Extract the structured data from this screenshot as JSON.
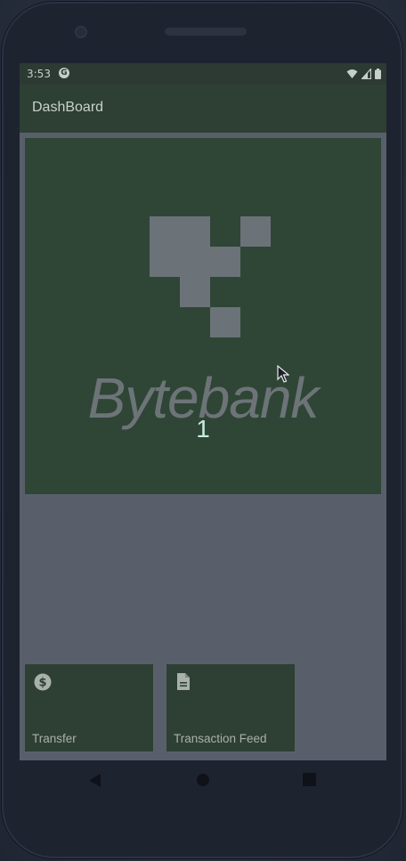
{
  "status": {
    "time": "3:53",
    "app_glyph": "G"
  },
  "app_bar": {
    "title": "DashBoard"
  },
  "banner": {
    "brand": "Bytebank",
    "count": "1"
  },
  "cards": [
    {
      "label": "Transfer",
      "icon": "dollar-circle-icon"
    },
    {
      "label": "Transaction Feed",
      "icon": "document-icon"
    }
  ],
  "colors": {
    "primary": "#2d4033",
    "banner": "#2f4636",
    "screen_overlay": "#585f6b",
    "accent_text": "#c8ede0"
  }
}
